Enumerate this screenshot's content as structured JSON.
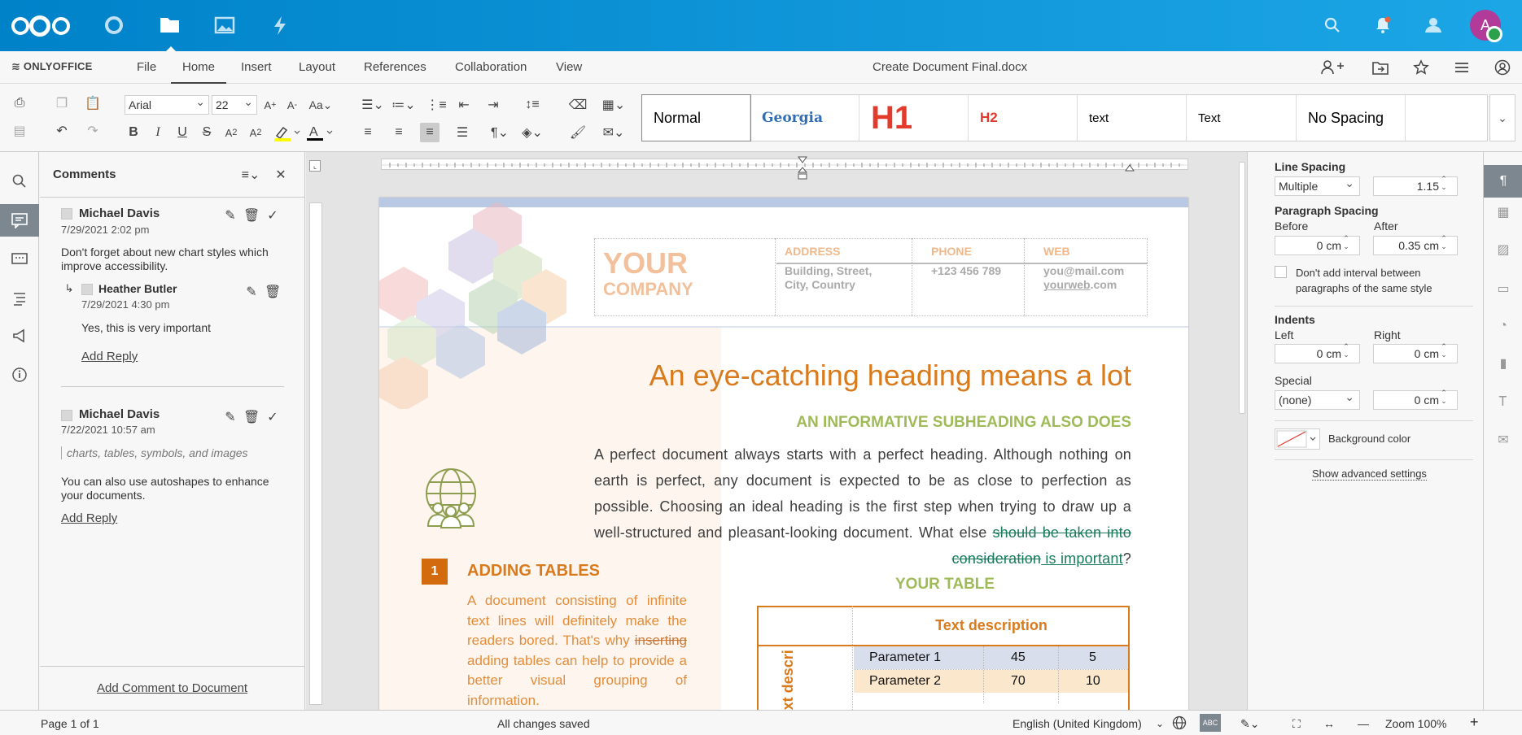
{
  "topbar": {
    "avatar_letter": "A"
  },
  "menubar": {
    "brand": "ONLYOFFICE",
    "tabs": [
      "File",
      "Home",
      "Insert",
      "Layout",
      "References",
      "Collaboration",
      "View"
    ],
    "active_tab": "Home",
    "document_title": "Create Document Final.docx"
  },
  "toolbar": {
    "font_name": "Arial",
    "font_size": "22",
    "styles": [
      "Normal",
      "Georgia",
      "H1",
      "H2",
      "text",
      "Text",
      "No Spacing"
    ],
    "selected_style": "Normal",
    "colors": {
      "highlight": "#ffff00",
      "font_color": "#000000",
      "h1": "#e23b2b",
      "georgia": "#2f6db5"
    }
  },
  "comments": {
    "title": "Comments",
    "items": [
      {
        "author": "Michael Davis",
        "date": "7/29/2021 2:02 pm",
        "text": "Don't forget about new chart styles which improve accessibility.",
        "reply": {
          "author": "Heather Butler",
          "date": "7/29/2021 4:30 pm",
          "text": "Yes, this is very important"
        },
        "add_reply": "Add Reply"
      },
      {
        "author": "Michael Davis",
        "date": "7/22/2021 10:57 am",
        "quote": "charts, tables, symbols, and images",
        "text": "You can also use autoshapes to enhance your documents.",
        "add_reply": "Add Reply"
      }
    ],
    "add_to_document": "Add Comment to Document"
  },
  "document": {
    "company_line1": "YOUR",
    "company_line2": "COMPANY",
    "address_label": "ADDRESS",
    "address_value_1": "Building, Street,",
    "address_value_2": "City, Country",
    "phone_label": "PHONE",
    "phone_value": "+123 456 789",
    "web_label": "WEB",
    "web_email": "you@mail.com",
    "web_url_underlined": "yourweb",
    "web_url_rest": ".com",
    "heading": "An eye-catching heading means a lot",
    "subheading": "AN INFORMATIVE SUBHEADING ALSO DOES",
    "paragraph_start": "A perfect document always starts with a perfect heading. Although nothing on earth is perfect, any document is expected to be as close to perfection as possible. Choosing an ideal heading is the first step when trying to draw up a well-structured and pleasant-looking document. What else ",
    "paragraph_deleted": "should be taken into consideration",
    "paragraph_inserted": " is important",
    "paragraph_end": "?",
    "section_number": "1",
    "section_title": "ADDING TABLES",
    "section_text_start": "A document consisting of infinite text lines will definitely make the readers bored. That's why ",
    "section_text_deleted": "inserting",
    "section_text_end": " adding tables can help to provide a better visual grouping of information.",
    "table_title": "YOUR TABLE",
    "table_header": "Text description",
    "table_side_label": "Text description",
    "table_rows": [
      {
        "param": "Parameter 1",
        "a": "45",
        "b": "5"
      },
      {
        "param": "Parameter 2",
        "a": "70",
        "b": "10"
      }
    ]
  },
  "settings": {
    "line_spacing_label": "Line Spacing",
    "line_spacing_mode": "Multiple",
    "line_spacing_value": "1.15",
    "paragraph_spacing_label": "Paragraph Spacing",
    "before_label": "Before",
    "before_value": "0 cm",
    "after_label": "After",
    "after_value": "0.35 cm",
    "no_interval_label": "Don't add interval between paragraphs of the same style",
    "indents_label": "Indents",
    "left_label": "Left",
    "left_value": "0 cm",
    "right_label": "Right",
    "right_value": "0 cm",
    "special_label": "Special",
    "special_value": "(none)",
    "special_amount": "0 cm",
    "background_color_label": "Background color",
    "advanced_label": "Show advanced settings"
  },
  "statusbar": {
    "page": "Page 1 of 1",
    "saved": "All changes saved",
    "language": "English (United Kingdom)",
    "zoom": "Zoom 100%"
  }
}
